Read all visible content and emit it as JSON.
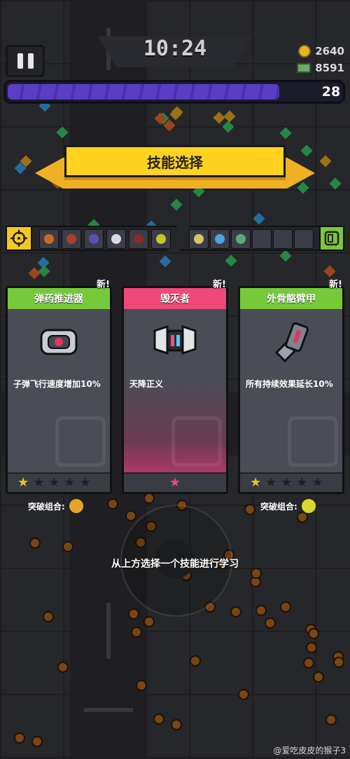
{
  "hud": {
    "timer": "10:24",
    "coins": "2640",
    "cash": "8591",
    "level": "28",
    "xp_fraction": 0.9
  },
  "banner": {
    "title": "技能选择"
  },
  "slots": {
    "left_icon": "crosshair-icon",
    "right_icon": "card-icon",
    "weapons": [
      "#c76a2a",
      "#a8412f",
      "#5b4fb5",
      "#d8d8e8",
      "#8a2a2a",
      "#c7c728"
    ],
    "passives": [
      "#d9c26a",
      "#4aa0e0",
      "#5aaa7a"
    ]
  },
  "cards": [
    {
      "new_label": "新!",
      "title": "弹药推进器",
      "head_color": "#76c93a",
      "body_color": "#5a5c66",
      "icon": "thruster-icon",
      "desc": "子弹飞行速度增加10%",
      "stars_filled": 1,
      "stars_total": 5,
      "combo_label": "突破组合:",
      "combo_icon": "drill-icon"
    },
    {
      "new_label": "新!",
      "title": "毁灭者",
      "head_color": "#f0487a",
      "body_color": "#6b3a52",
      "icon": "destroyer-icon",
      "desc": "天降正义",
      "stars_filled": 1,
      "stars_total": 1,
      "combo_label": "",
      "combo_icon": ""
    },
    {
      "new_label": "新!",
      "title": "外骨骼臂甲",
      "head_color": "#76c93a",
      "body_color": "#5a5c66",
      "icon": "exoskeleton-arm-icon",
      "desc": "所有持续效果延长10%",
      "stars_filled": 1,
      "stars_total": 5,
      "combo_label": "突破组合:",
      "combo_icon": "radioactive-icon"
    }
  ],
  "hint": "从上方选择一个技能进行学习",
  "credit": "@爱吃皮皮的猴子3"
}
